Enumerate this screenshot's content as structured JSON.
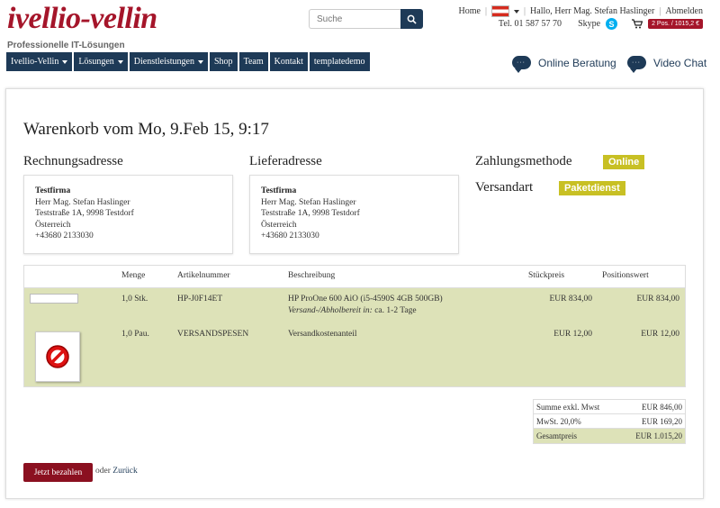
{
  "header": {
    "logo": "ivellio-vellin",
    "tagline": "Professionelle IT-Lösungen",
    "search_placeholder": "Suche",
    "home": "Home",
    "greeting": "Hallo, Herr Mag. Stefan Haslinger",
    "logout": "Abmelden",
    "phone": "Tel. 01 587 57 70",
    "skype": "Skype",
    "cart_badge": "2 Pos. / 1015,2 €"
  },
  "nav": {
    "items": [
      {
        "label": "Ivellio-Vellin",
        "dropdown": true
      },
      {
        "label": "Lösungen",
        "dropdown": true
      },
      {
        "label": "Dienstleistungen",
        "dropdown": true
      },
      {
        "label": "Shop",
        "dropdown": false
      },
      {
        "label": "Team",
        "dropdown": false
      },
      {
        "label": "Kontakt",
        "dropdown": false
      },
      {
        "label": "templatedemo",
        "dropdown": false
      }
    ],
    "online_beratung": "Online Beratung",
    "video_chat": "Video Chat"
  },
  "cart": {
    "title": "Warenkorb vom Mo, 9.Feb 15, 9:17",
    "billing": {
      "heading": "Rechnungsadresse",
      "lines": [
        "Testfirma",
        "Herr Mag. Stefan Haslinger",
        "Teststraße 1A, 9998 Testdorf",
        "Österreich",
        "+43680 2133030"
      ]
    },
    "shipping": {
      "heading": "Lieferadresse",
      "lines": [
        "Testfirma",
        "Herr Mag. Stefan Haslinger",
        "Teststraße 1A, 9998 Testdorf",
        "Österreich",
        "+43680 2133030"
      ]
    },
    "payment_label": "Zahlungsmethode",
    "payment_value": "Online",
    "shipping_label": "Versandart",
    "shipping_value": "Paketdienst",
    "table": {
      "headers": {
        "menge": "Menge",
        "artikel": "Artikelnummer",
        "beschreibung": "Beschreibung",
        "stueck": "Stückpreis",
        "position": "Positionswert"
      },
      "rows": [
        {
          "menge": "1,0 Stk.",
          "artikel": "HP-J0F14ET",
          "beschreibung": "HP ProOne 600 AiO (i5-4590S 4GB 500GB)",
          "availability_label": "Versand-/Abholbereit in:",
          "availability_value": "ca. 1-2 Tage",
          "stueck": "EUR 834,00",
          "position": "EUR 834,00"
        },
        {
          "menge": "1,0 Pau.",
          "artikel": "VERSANDSPESEN",
          "beschreibung": "Versandkostenanteil",
          "stueck": "EUR 12,00",
          "position": "EUR 12,00"
        }
      ]
    },
    "totals": [
      {
        "label": "Summe exkl. Mwst",
        "value": "EUR 846,00"
      },
      {
        "label": "MwSt. 20,0%",
        "value": "EUR 169,20"
      },
      {
        "label": "Gesamtpreis",
        "value": "EUR 1.015,20"
      }
    ],
    "pay_button": "Jetzt bezahlen",
    "or_text": "oder",
    "back_link": "Zurück"
  },
  "colors": {
    "brand_red": "#a5152a",
    "nav_blue": "#1e3a57",
    "badge_olive": "#c8c024",
    "row_olive": "#dde2b8"
  }
}
